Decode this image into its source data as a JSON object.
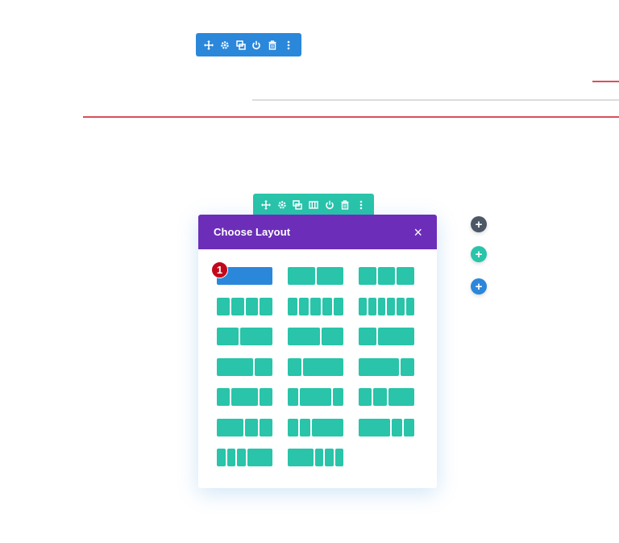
{
  "colors": {
    "blue": "#2b87da",
    "teal": "#29c4a9",
    "purple": "#6c2eb9",
    "red": "#d8505e",
    "dark": "#4c5866"
  },
  "section_toolbar": {
    "icons": [
      "move-icon",
      "gear-icon",
      "duplicate-icon",
      "power-icon",
      "trash-icon",
      "more-icon"
    ]
  },
  "row_toolbar": {
    "icons": [
      "move-icon",
      "gear-icon",
      "duplicate-icon",
      "columns-icon",
      "power-icon",
      "trash-icon",
      "more-icon"
    ]
  },
  "modal": {
    "title": "Choose Layout",
    "close_label": "×"
  },
  "step_badge": "1",
  "layouts": [
    {
      "name": "1-column",
      "columns": [
        1
      ],
      "selected": true
    },
    {
      "name": "2-columns-equal",
      "columns": [
        1,
        1
      ]
    },
    {
      "name": "3-columns-equal",
      "columns": [
        1,
        1,
        1
      ]
    },
    {
      "name": "4-columns-equal",
      "columns": [
        1,
        1,
        1,
        1
      ]
    },
    {
      "name": "5-columns-equal",
      "columns": [
        1,
        1,
        1,
        1,
        1
      ]
    },
    {
      "name": "6-columns-equal",
      "columns": [
        1,
        1,
        1,
        1,
        1,
        1
      ]
    },
    {
      "name": "2-5-3-5",
      "columns": [
        2,
        3
      ]
    },
    {
      "name": "3-5-2-5",
      "columns": [
        3,
        2
      ]
    },
    {
      "name": "1-3-2-3",
      "columns": [
        1,
        2
      ]
    },
    {
      "name": "2-3-1-3",
      "columns": [
        2,
        1
      ]
    },
    {
      "name": "1-4-3-4",
      "columns": [
        1,
        3
      ]
    },
    {
      "name": "3-4-1-4",
      "columns": [
        3,
        1
      ]
    },
    {
      "name": "1-4-1-2-1-4",
      "columns": [
        1,
        2,
        1
      ]
    },
    {
      "name": "1-5-3-5-1-5",
      "columns": [
        1,
        3,
        1
      ]
    },
    {
      "name": "1-4-1-4-1-2",
      "columns": [
        1,
        1,
        2
      ]
    },
    {
      "name": "1-2-1-4-1-4",
      "columns": [
        2,
        1,
        1
      ]
    },
    {
      "name": "1-5-1-5-3-5",
      "columns": [
        1,
        1,
        3
      ]
    },
    {
      "name": "3-5-1-5-1-5",
      "columns": [
        3,
        1,
        1
      ]
    },
    {
      "name": "1-6-1-6-1-6-1-2",
      "columns": [
        1,
        1,
        1,
        3
      ]
    },
    {
      "name": "1-2-1-6-1-6-1-6",
      "columns": [
        3,
        1,
        1,
        1
      ]
    }
  ],
  "add_buttons": {
    "module_label": "+",
    "row_label": "+",
    "section_label": "+"
  }
}
